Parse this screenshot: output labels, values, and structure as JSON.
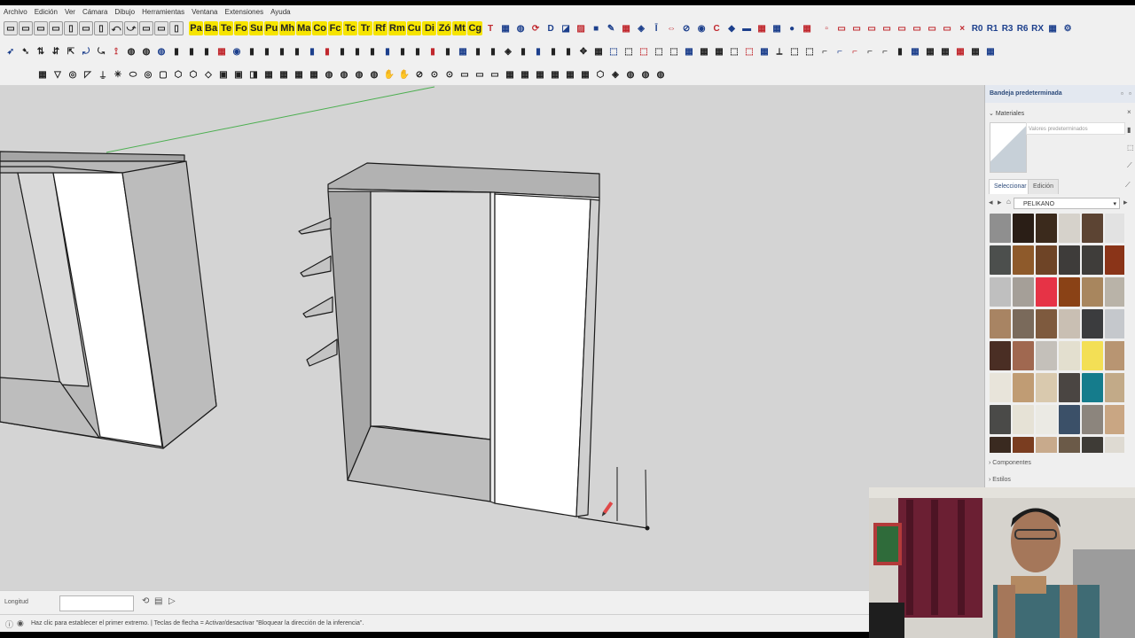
{
  "menu": [
    "Archivo",
    "Edición",
    "Ver",
    "Cámara",
    "Dibujo",
    "Herramientas",
    "Ventana",
    "Extensiones",
    "Ayuda"
  ],
  "toolbar_row1_plugin_labels": [
    "Pa",
    "Ba",
    "Te",
    "Fo",
    "Su",
    "Pu",
    "Mh",
    "Ma",
    "Co",
    "Fc",
    "Tc",
    "Tr",
    "Rf",
    "Rm",
    "Cu",
    "Di",
    "Zó",
    "Mt",
    "Cg"
  ],
  "toolbar_row1_right_labels": [
    "R0",
    "R1",
    "R3",
    "R6",
    "RX"
  ],
  "viewport": {
    "colors": {
      "background": "#d4d4d4",
      "face_gray": "#b8b8b8",
      "face_white": "#ffffff",
      "edge": "#1a1a1a",
      "axis_green": "#4caf50"
    }
  },
  "vcb": {
    "label": "Longitud",
    "value": ""
  },
  "status": {
    "text": "Haz clic para establecer el primer extremo. | Teclas de flecha = Activar/desactivar \"Bloquear la dirección de la inferencia\"."
  },
  "tray": {
    "title": "Bandeja predeterminada",
    "materials_header": "Materiales",
    "material_name_placeholder": "Valores predeterminados",
    "tab_select": "Seleccionar",
    "tab_edit": "Edición",
    "library": "PELIKANO",
    "components": "Componentes",
    "styles": "Estilos",
    "swatches": [
      "#8f8f8f",
      "#2a1e16",
      "#3b2a1c",
      "#d6d2cb",
      "#5c4433",
      "#e2e2e2",
      "#4c4f4d",
      "#8e5a2b",
      "#6e4426",
      "#3e3c3a",
      "#3f3d3a",
      "#8a3418",
      "#bfbfbf",
      "#a59f98",
      "#e63346",
      "#8a4216",
      "#a8865e",
      "#b9b3a8",
      "#a88463",
      "#7a6a5b",
      "#7e5a3e",
      "#c9bfb3",
      "#3b3c3e",
      "#c5c8cc",
      "#4a2e24",
      "#a06850",
      "#c4c0ba",
      "#e3dfcf",
      "#f3df55",
      "#b89572",
      "#e8e4da",
      "#c09c74",
      "#d9c9ae",
      "#4a4542",
      "#157c8c",
      "#c2aa88",
      "#4a4a48",
      "#e6e2d6",
      "#ebeae4",
      "#3b5068",
      "#8c857d",
      "#c9a683",
      "#3a2a20",
      "#7a3d20",
      "#c8aa8c",
      "#6b5a48",
      "#3e3b36",
      "#dedad2"
    ]
  },
  "icons": [
    "search-icon",
    "new-file-icon",
    "open-icon",
    "save-icon",
    "undo-icon",
    "redo-icon",
    "pencil-cursor-icon"
  ]
}
